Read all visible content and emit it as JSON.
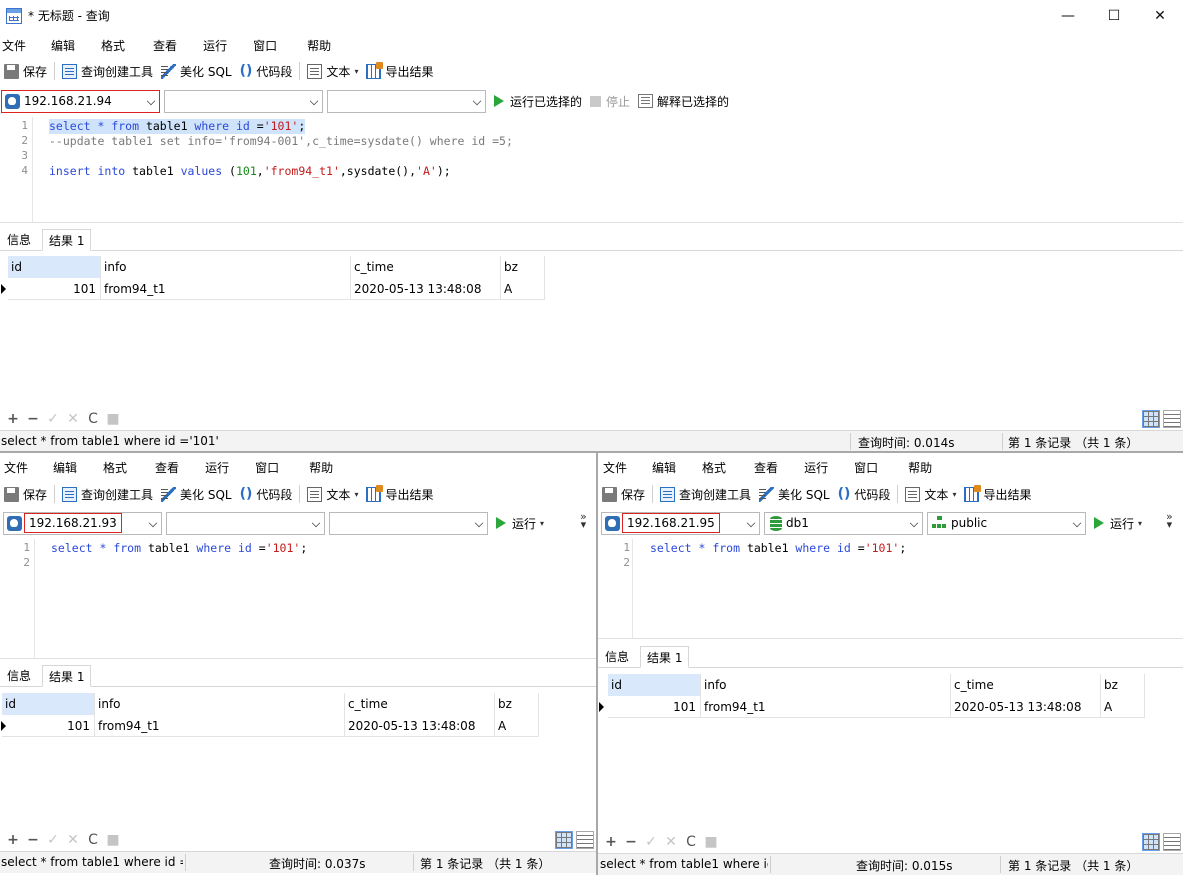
{
  "window": {
    "title": "* 无标题 - 查询",
    "controls": {
      "minimize": "—",
      "maximize": "☐",
      "close": "✕"
    }
  },
  "menu": [
    "文件",
    "编辑",
    "格式",
    "查看",
    "运行",
    "窗口",
    "帮助"
  ],
  "toolbar": {
    "save": "保存",
    "query_builder": "查询创建工具",
    "beautify": "美化 SQL",
    "snippet": "代码段",
    "snippet_glyph": "()",
    "text": "文本",
    "export": "导出结果"
  },
  "top": {
    "connection": "192.168.21.94",
    "database": "",
    "schema": "",
    "run_selected": "运行已选择的",
    "stop": "停止",
    "explain_selected": "解释已选择的",
    "lines": [
      "1",
      "2",
      "3",
      "4"
    ],
    "code": {
      "l1": [
        {
          "t": "select",
          "c": "kw"
        },
        {
          "t": " * ",
          "c": "kw"
        },
        {
          "t": "from",
          "c": "kw"
        },
        {
          "t": " table1 ",
          "c": ""
        },
        {
          "t": "where",
          "c": "kw"
        },
        {
          "t": " id ",
          "c": "kw"
        },
        {
          "t": "=",
          "c": ""
        },
        {
          "t": "'101'",
          "c": "str"
        },
        {
          "t": ";",
          "c": ""
        }
      ],
      "l2": "--update table1 set info='from94-001',c_time=sysdate() where id =5;",
      "l4": [
        {
          "t": "insert",
          "c": "kw"
        },
        {
          "t": " ",
          "c": ""
        },
        {
          "t": "into",
          "c": "kw"
        },
        {
          "t": " table1 ",
          "c": ""
        },
        {
          "t": "values",
          "c": "kw"
        },
        {
          "t": " (",
          "c": ""
        },
        {
          "t": "101",
          "c": "num"
        },
        {
          "t": ",",
          "c": ""
        },
        {
          "t": "'from94_t1'",
          "c": "str"
        },
        {
          "t": ",sysdate(),",
          "c": ""
        },
        {
          "t": "'A'",
          "c": "str"
        },
        {
          "t": ");",
          "c": ""
        }
      ]
    },
    "tabs": {
      "info": "信息",
      "result": "结果 1"
    },
    "columns": [
      "id",
      "info",
      "c_time",
      "bz"
    ],
    "rows": [
      [
        "101",
        "from94_t1",
        "2020-05-13 13:48:08",
        "A"
      ]
    ],
    "status": {
      "sql": "select * from table1 where id ='101'",
      "time": "查询时间: 0.014s",
      "records": "第 1 条记录 （共 1 条）"
    }
  },
  "left": {
    "connection": "192.168.21.93",
    "database": "",
    "schema": "",
    "run": "运行",
    "lines": [
      "1",
      "2"
    ],
    "code": [
      {
        "t": "select",
        "c": "kw"
      },
      {
        "t": " * ",
        "c": "kw"
      },
      {
        "t": "from",
        "c": "kw"
      },
      {
        "t": " table1 ",
        "c": ""
      },
      {
        "t": "where",
        "c": "kw"
      },
      {
        "t": " id ",
        "c": "kw"
      },
      {
        "t": "=",
        "c": ""
      },
      {
        "t": "'101'",
        "c": "str"
      },
      {
        "t": ";",
        "c": ""
      }
    ],
    "tabs": {
      "info": "信息",
      "result": "结果 1"
    },
    "columns": [
      "id",
      "info",
      "c_time",
      "bz"
    ],
    "rows": [
      [
        "101",
        "from94_t1",
        "2020-05-13 13:48:08",
        "A"
      ]
    ],
    "status": {
      "sql": "select * from table1 where id =",
      "time": "查询时间: 0.037s",
      "records": "第 1 条记录 （共 1 条）"
    }
  },
  "right": {
    "connection": "192.168.21.95",
    "database": "db1",
    "schema": "public",
    "run": "运行",
    "lines": [
      "1",
      "2"
    ],
    "code": [
      {
        "t": "select",
        "c": "kw"
      },
      {
        "t": " * ",
        "c": "kw"
      },
      {
        "t": "from",
        "c": "kw"
      },
      {
        "t": " table1 ",
        "c": ""
      },
      {
        "t": "where",
        "c": "kw"
      },
      {
        "t": " id ",
        "c": "kw"
      },
      {
        "t": "=",
        "c": ""
      },
      {
        "t": "'101'",
        "c": "str"
      },
      {
        "t": ";",
        "c": ""
      }
    ],
    "tabs": {
      "info": "信息",
      "result": "结果 1"
    },
    "columns": [
      "id",
      "info",
      "c_time",
      "bz"
    ],
    "rows": [
      [
        "101",
        "from94_t1",
        "2020-05-13 13:48:08",
        "A"
      ]
    ],
    "status": {
      "sql": "select * from table1 where id",
      "time": "查询时间: 0.015s",
      "records": "第 1 条记录 （共 1 条）"
    }
  },
  "gridtools": {
    "add": "+",
    "remove": "−",
    "apply": "✓",
    "discard": "✕",
    "refresh": "C",
    "stop": "■"
  },
  "icons": {
    "more": "»",
    "more_caret": "▾"
  }
}
